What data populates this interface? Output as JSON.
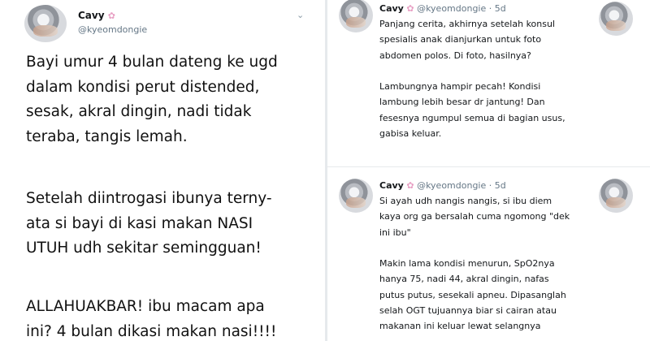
{
  "left_tweet": {
    "name": "Cavy",
    "badge_icon": "sakura-flower-icon",
    "handle": "@kyeomdongie",
    "menu_icon": "chevron-down-icon",
    "paragraph1": "Bayi umur 4 bulan dateng ke ugd\ndalam kondisi perut distended,\nsesak, akral dingin, nadi tidak\nteraba, tangis lemah.",
    "paragraph2": "Setelah diintrogasi ibunya terny-\nata si bayi di kasi makan NASI\nUTUH udh sekitar semingguan!",
    "paragraph3": "ALLAHUAKBAR! ibu macam apa\nini? 4 bulan dikasi makan nasi!!!!"
  },
  "right_tweets": [
    {
      "name": "Cavy",
      "handle": "@kyeomdongie",
      "age": "5d",
      "body": "Panjang cerita, akhirnya setelah konsul\nspesialis anak dianjurkan untuk foto\nabdomen polos. Di foto, hasilnya?\n\nLambungnya hampir pecah! Kondisi\nlambung lebih besar dr jantung! Dan\nfesesnya ngumpul semua di bagian usus,\ngabisa keluar."
    },
    {
      "name": "Cavy",
      "handle": "@kyeomdongie",
      "age": "5d",
      "body": "Si ayah udh nangis nangis, si ibu diem\nkaya org ga bersalah cuma ngomong \"dek\nini ibu\"\n\nMakin lama kondisi menurun, SpO2nya\nhanya 75, nadi 44, akral dingin, nafas\nputus putus, sesekali apneu. Dipasanglah\nselah OGT tujuannya biar si cairan atau\nmakanan ini keluar lewat selangnya"
    }
  ],
  "colors": {
    "handle": "#657786",
    "badge": "#e8a0c4",
    "separator": "#e6e9ec"
  }
}
